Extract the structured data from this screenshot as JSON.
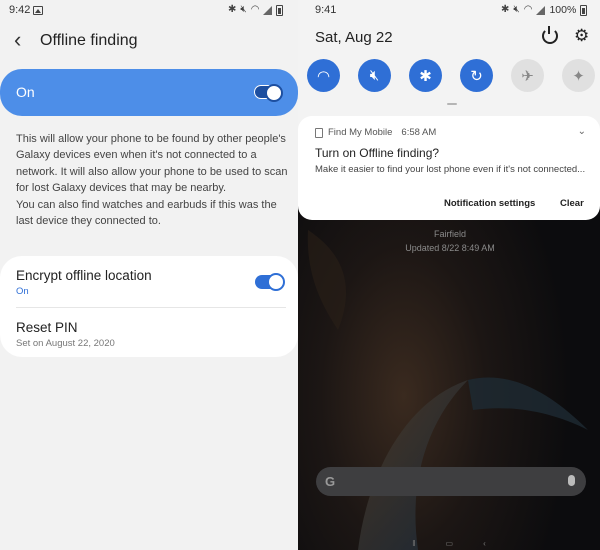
{
  "left": {
    "status": {
      "time": "9:42",
      "icons": [
        "bluetooth-icon",
        "mute-icon",
        "wifi-icon",
        "signal-icon",
        "battery-icon"
      ]
    },
    "header": {
      "title": "Offline finding",
      "back_icon": "back-arrow-icon"
    },
    "master_toggle": {
      "label": "On",
      "state": true
    },
    "description": [
      "This will allow your phone to be found by other people's Galaxy devices even when it's not connected to a network. It will also allow your phone to be used to scan for lost Galaxy devices that may be nearby.",
      "You can also find watches and earbuds if this was the last device they connected to."
    ],
    "settings": [
      {
        "title": "Encrypt offline location",
        "subtitle": "On",
        "toggle": true
      },
      {
        "title": "Reset PIN",
        "subtitle": "Set on August 22, 2020"
      }
    ],
    "colors": {
      "accent": "#4d8ee8",
      "accent_dark": "#2f6fd6",
      "bg": "#f2f2f2"
    }
  },
  "right": {
    "status": {
      "time": "9:41",
      "battery": "100%"
    },
    "date": "Sat, Aug 22",
    "quick_settings": [
      {
        "icon": "wifi-icon",
        "active": true
      },
      {
        "icon": "sound-mute-icon",
        "active": true
      },
      {
        "icon": "bluetooth-icon",
        "active": true
      },
      {
        "icon": "auto-rotate-icon",
        "active": true
      },
      {
        "icon": "airplane-icon",
        "active": false
      },
      {
        "icon": "flashlight-icon",
        "active": false
      }
    ],
    "notification": {
      "app": "Find My Mobile",
      "time": "6:58 AM",
      "title": "Turn on Offline finding?",
      "text": "Make it easier to find your lost phone even if it's not connected...",
      "actions": [
        "Notification settings",
        "Clear"
      ]
    },
    "weather": {
      "location": "Fairfield",
      "updated": "Updated 8/22 8:49 AM"
    }
  }
}
